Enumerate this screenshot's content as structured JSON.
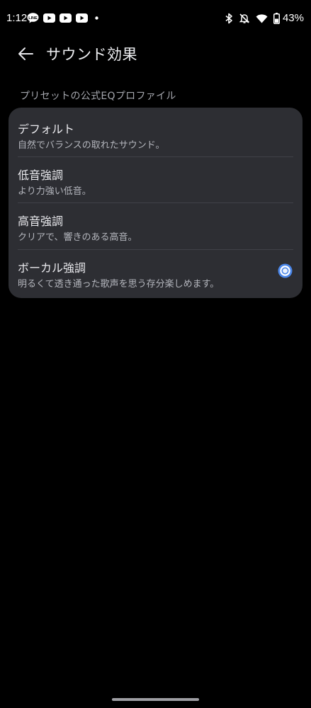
{
  "status_bar": {
    "time": "1:12",
    "battery_percent": "43%",
    "notification_icons": [
      "line-icon",
      "youtube-icon",
      "youtube-icon",
      "youtube-icon",
      "dot-icon"
    ],
    "system_icons": [
      "bluetooth-icon",
      "mute-icon",
      "wifi-icon",
      "battery-icon"
    ]
  },
  "app_bar": {
    "title": "サウンド効果"
  },
  "section": {
    "header": "プリセットの公式EQプロファイル"
  },
  "options": [
    {
      "title": "デフォルト",
      "subtitle": "自然でバランスの取れたサウンド。",
      "selected": false
    },
    {
      "title": "低音強調",
      "subtitle": "より力強い低音。",
      "selected": false
    },
    {
      "title": "高音強調",
      "subtitle": "クリアで、響きのある高音。",
      "selected": false
    },
    {
      "title": "ボーカル強調",
      "subtitle": "明るくて透き通った歌声を思う存分楽しめます。",
      "selected": true
    }
  ],
  "colors": {
    "background": "#000000",
    "card": "#2d2e33",
    "accent": "#4a86e8"
  }
}
